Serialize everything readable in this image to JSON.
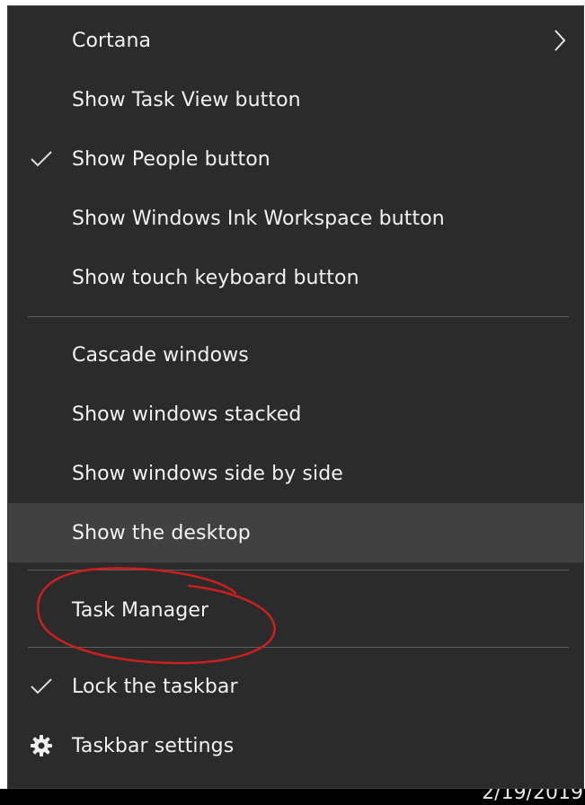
{
  "menu": {
    "items": [
      {
        "label": "Cortana",
        "lead": "",
        "trail": "chevron-right-icon"
      },
      {
        "label": "Show Task View button",
        "lead": "",
        "trail": ""
      },
      {
        "label": "Show People button",
        "lead": "checkmark-icon",
        "trail": ""
      },
      {
        "label": "Show Windows Ink Workspace button",
        "lead": "",
        "trail": ""
      },
      {
        "label": "Show touch keyboard button",
        "lead": "",
        "trail": ""
      },
      {
        "label": "Cascade windows",
        "lead": "",
        "trail": ""
      },
      {
        "label": "Show windows stacked",
        "lead": "",
        "trail": ""
      },
      {
        "label": "Show windows side by side",
        "lead": "",
        "trail": ""
      },
      {
        "label": "Show the desktop",
        "lead": "",
        "trail": "",
        "state": "hovered"
      },
      {
        "label": "Task Manager",
        "lead": "",
        "trail": "",
        "annotated": "red-circle"
      },
      {
        "label": "Lock the taskbar",
        "lead": "checkmark-icon",
        "trail": ""
      },
      {
        "label": "Taskbar settings",
        "lead": "gear-icon",
        "trail": ""
      }
    ]
  },
  "taskbar": {
    "clock_date": "2/19/2019"
  },
  "colors": {
    "menu_background": "#2b2b2b",
    "hover_background": "#414141",
    "text": "#f2f2f2",
    "separator": "#5e5e5e",
    "annotation": "#cc1f1f"
  }
}
